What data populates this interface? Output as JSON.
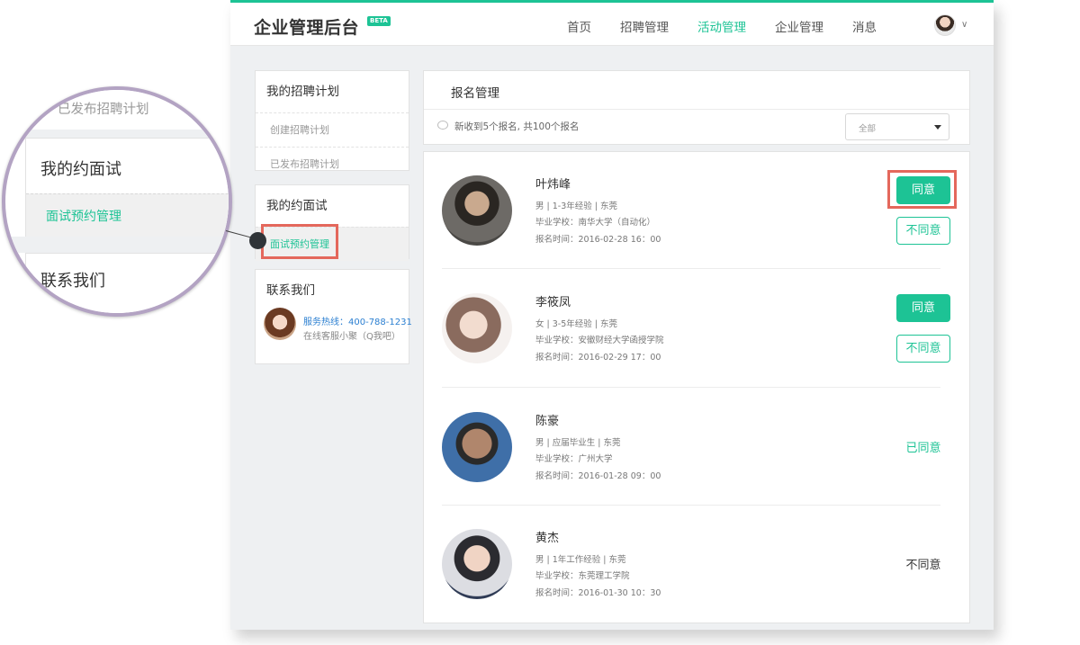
{
  "header": {
    "brand": "企业管理后台",
    "badge": "BETA",
    "nav": [
      "首页",
      "招聘管理",
      "活动管理",
      "企业管理",
      "消息"
    ],
    "active_nav_index": 2
  },
  "sidebar": {
    "recruit_plan": {
      "title": "我的招聘计划",
      "items": [
        "创建招聘计划",
        "已发布招聘计划"
      ]
    },
    "interview": {
      "title": "我的约面试",
      "items": [
        "面试预约管理"
      ]
    },
    "contact": {
      "title": "联系我们",
      "hotline": "服务热线：400-788-1231",
      "online": "在线客服小聚（Q我吧）"
    }
  },
  "content": {
    "title": "报名管理",
    "notice": "新收到5个报名, 共100个报名",
    "filter_value": "全部",
    "candidates": [
      {
        "name": "叶炜峰",
        "info": "男 | 1-3年经验 | 东莞",
        "school": "毕业学校：南华大学（自动化）",
        "time": "报名时间：2016-02-28 16：00",
        "state": "pending",
        "agree": "同意",
        "disagree": "不同意"
      },
      {
        "name": "李筱凤",
        "info": "女 | 3-5年经验 | 东莞",
        "school": "毕业学校：安徽财经大学函授学院",
        "time": "报名时间：2016-02-29 17：00",
        "state": "pending",
        "agree": "同意",
        "disagree": "不同意"
      },
      {
        "name": "陈豪",
        "info": "男 | 应届毕业生 | 东莞",
        "school": "毕业学校：广州大学",
        "time": "报名时间：2016-01-28 09：00",
        "state": "agreed",
        "status_text": "已同意"
      },
      {
        "name": "黄杰",
        "info": "男 | 1年工作经验 | 东莞",
        "school": "毕业学校：东莞理工学院",
        "time": "报名时间：2016-01-30 10：30",
        "state": "rejected",
        "status_text": "不同意"
      }
    ]
  },
  "magnifier": {
    "top_text": "已发布招聘计划",
    "section_title": "我的约面试",
    "item": "面试预约管理",
    "bottom_title": "联系我们"
  },
  "colors": {
    "accent": "#1dc395",
    "highlight": "#e4685c",
    "link": "#2b7fd1"
  }
}
